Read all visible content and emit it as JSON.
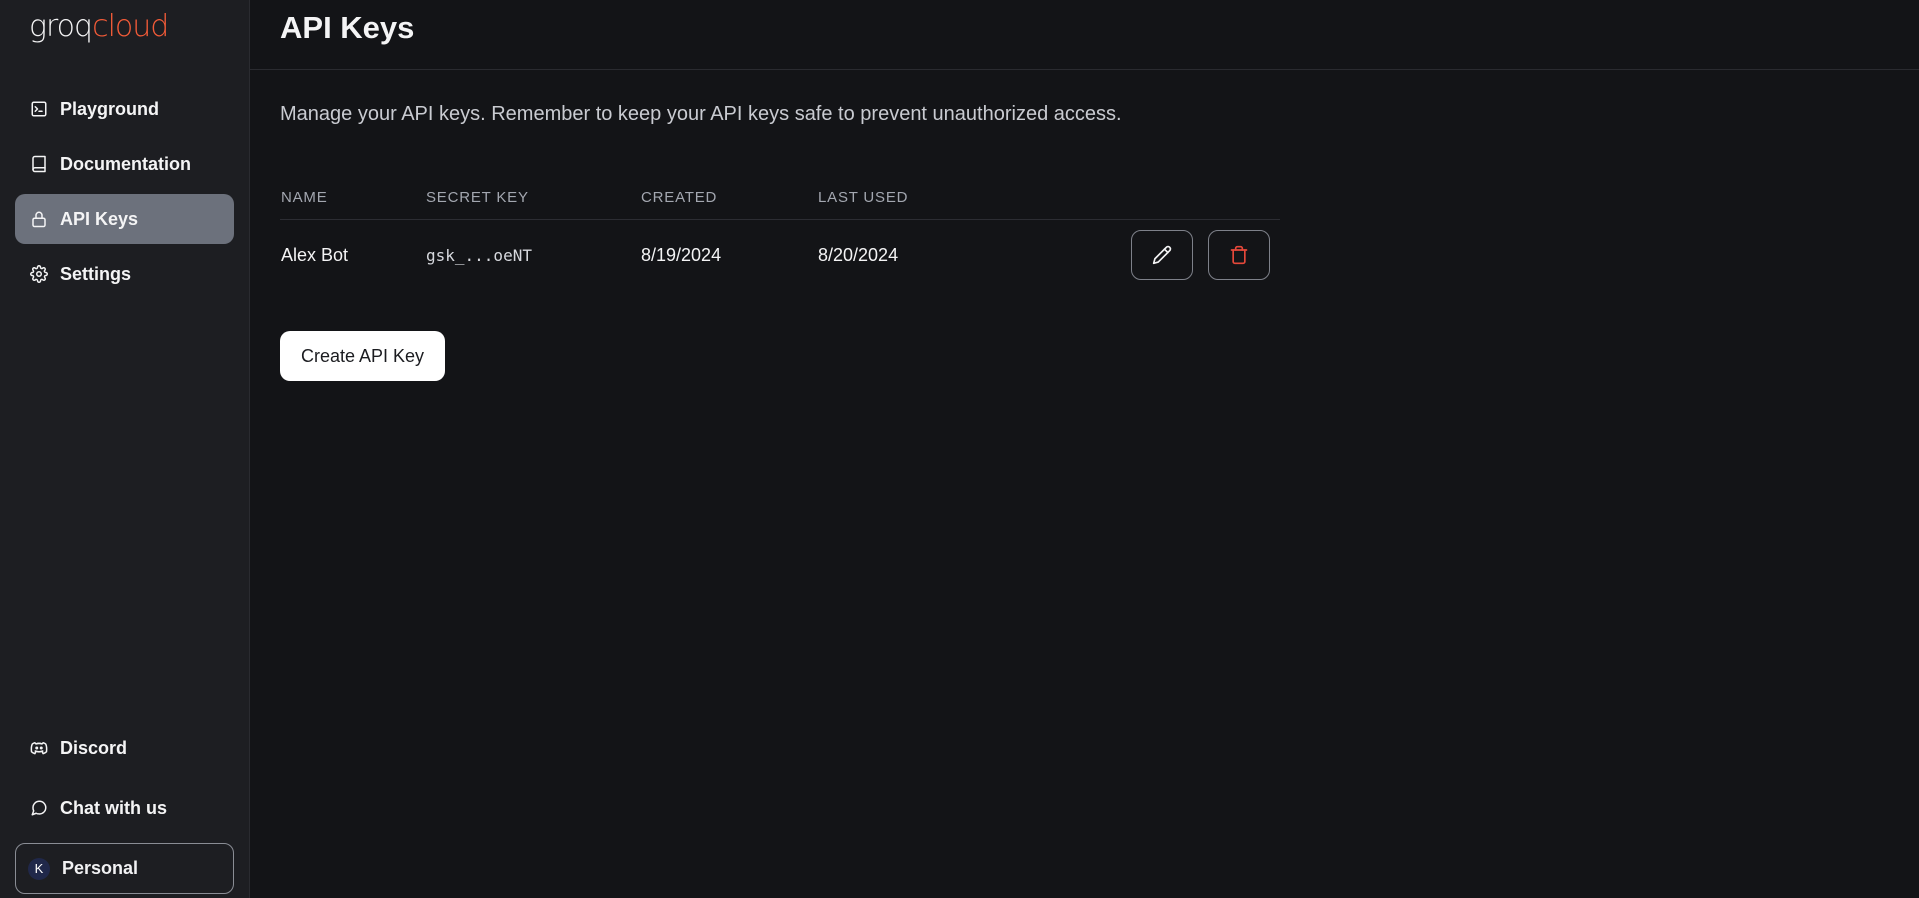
{
  "brand": {
    "logo_part1": "groq",
    "logo_part2": "cloud",
    "accent_color": "#f35b38"
  },
  "sidebar": {
    "items": [
      {
        "label": "Playground",
        "icon": "terminal-icon"
      },
      {
        "label": "Documentation",
        "icon": "book-icon"
      },
      {
        "label": "API Keys",
        "icon": "lock-icon",
        "active": true
      },
      {
        "label": "Settings",
        "icon": "gear-icon"
      }
    ],
    "bottom_items": [
      {
        "label": "Discord",
        "icon": "discord-icon"
      },
      {
        "label": "Chat with us",
        "icon": "chat-bubble-icon"
      }
    ],
    "workspace": {
      "avatar_letter": "K",
      "label": "Personal"
    }
  },
  "page": {
    "title": "API Keys",
    "description": "Manage your API keys. Remember to keep your API keys safe to prevent unauthorized access."
  },
  "table": {
    "columns": [
      "NAME",
      "SECRET KEY",
      "CREATED",
      "LAST USED"
    ],
    "rows": [
      {
        "name": "Alex Bot",
        "secret_key": "gsk_...oeNT",
        "created": "8/19/2024",
        "last_used": "8/20/2024"
      }
    ]
  },
  "actions": {
    "create_label": "Create API Key"
  }
}
